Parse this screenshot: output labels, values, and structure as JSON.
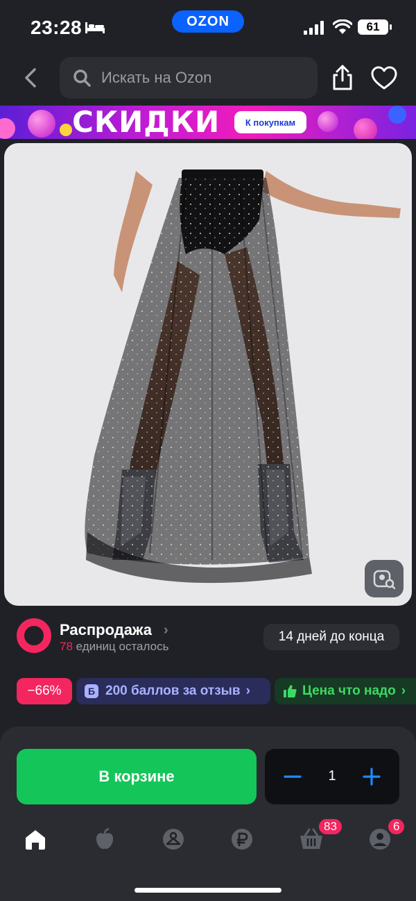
{
  "status_bar": {
    "time": "23:28",
    "brand": "OZON",
    "battery": "61",
    "icons": [
      "bed-icon",
      "signal-icon",
      "wifi-icon",
      "battery-icon"
    ]
  },
  "header": {
    "search_placeholder": "Искать на Ozon",
    "icons": [
      "back-icon",
      "search-icon",
      "share-icon",
      "heart-icon"
    ]
  },
  "banner": {
    "title": "СКИДКИ",
    "button": "К покупкам"
  },
  "product": {
    "image_alt": "",
    "icons": [
      "image-search-icon"
    ]
  },
  "sale": {
    "title": "Распродажа",
    "remaining_count": "78",
    "remaining_text": "единиц осталось",
    "days_left": "14 дней до конца"
  },
  "badges": {
    "discount": "−66%",
    "points_icon": "Б",
    "points": "200 баллов за отзыв",
    "price": "Цена что надо"
  },
  "cart": {
    "button": "В корзине",
    "quantity": "1",
    "minus": "−",
    "plus": "+"
  },
  "tabbar": {
    "tabs": [
      "home-icon",
      "fresh-icon",
      "catalog-icon",
      "finance-icon",
      "basket-icon",
      "profile-icon"
    ],
    "basket_count": "83",
    "profile_count": "6"
  },
  "colors": {
    "background": "#1f2126",
    "accent_blue": "#0a62ff",
    "accent_pink": "#f3265f",
    "accent_green": "#14c55a"
  }
}
